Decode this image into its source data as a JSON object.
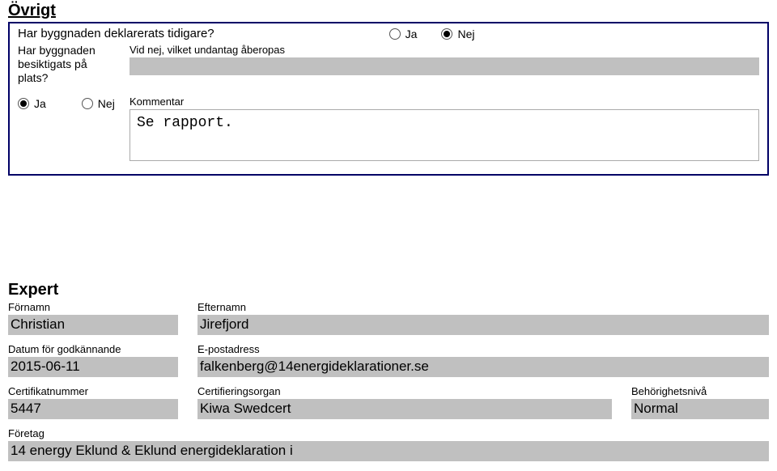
{
  "ovrigt": {
    "title": "Övrigt",
    "q_declared": "Har byggnaden deklarerats tidigare?",
    "declared_ja": "Ja",
    "declared_nej": "Nej",
    "declared_selected": "nej",
    "q_inspected": "Har byggnaden besiktigats på plats?",
    "inspected_ja": "Ja",
    "inspected_nej": "Nej",
    "inspected_selected": "ja",
    "exception_label": "Vid nej, vilket undantag åberopas",
    "exception_value": "",
    "comment_label": "Kommentar",
    "comment_value": "Se rapport."
  },
  "expert": {
    "title": "Expert",
    "fornamn_label": "Förnamn",
    "fornamn_value": "Christian",
    "efternamn_label": "Efternamn",
    "efternamn_value": "Jirefjord",
    "datum_label": "Datum för godkännande",
    "datum_value": "2015-06-11",
    "epost_label": "E-postadress",
    "epost_value": "falkenberg@14energideklarationer.se",
    "cert_label": "Certifikatnummer",
    "cert_value": "5447",
    "organ_label": "Certifieringsorgan",
    "organ_value": "Kiwa Swedcert",
    "niva_label": "Behörighetsnivå",
    "niva_value": "Normal",
    "foretag_label": "Företag",
    "foretag_value": "14 energy Eklund & Eklund energideklaration i"
  }
}
